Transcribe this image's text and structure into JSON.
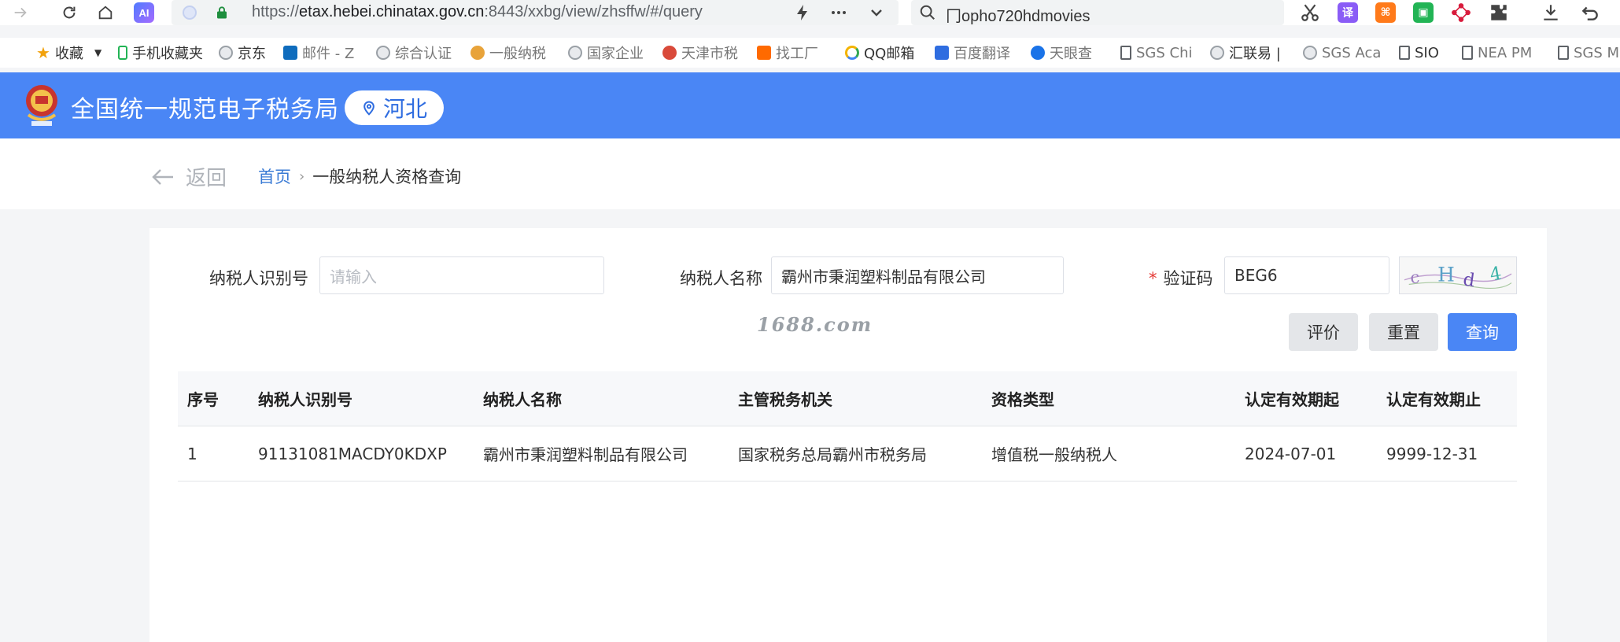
{
  "browser": {
    "url_prefix": "https://",
    "url_host": "etax.hebei.chinatax.gov.cn",
    "url_rest": ":8443/xxbg/view/zhsffw/#/query",
    "ai_badge": "AI",
    "search_text": "冂opho720hdmovies",
    "ext_translate": "译"
  },
  "bookmarks": [
    {
      "label": "收藏"
    },
    {
      "label": "手机收藏夹"
    },
    {
      "label": "京东"
    },
    {
      "label": "邮件 - Z"
    },
    {
      "label": "综合认证"
    },
    {
      "label": "一般纳税"
    },
    {
      "label": "国家企业"
    },
    {
      "label": "天津市税"
    },
    {
      "label": "找工厂"
    },
    {
      "label": "QQ邮箱"
    },
    {
      "label": "百度翻译"
    },
    {
      "label": "天眼查"
    },
    {
      "label": "SGS Chi"
    },
    {
      "label": "汇联易 |"
    },
    {
      "label": "SGS Aca"
    },
    {
      "label": "SIO"
    },
    {
      "label": "NEA PM"
    },
    {
      "label": "SGS M"
    }
  ],
  "header": {
    "title": "全国统一规范电子税务局",
    "region": "河北"
  },
  "subbar": {
    "back_label": "返回",
    "breadcrumb_home": "首页",
    "breadcrumb_sep": "›",
    "breadcrumb_current": "一般纳税人资格查询"
  },
  "form": {
    "taxpayer_id_label": "纳税人识别号",
    "taxpayer_id_placeholder": "请输入",
    "taxpayer_name_label": "纳税人名称",
    "taxpayer_name_value": "霸州市秉润塑料制品有限公司",
    "captcha_label": "验证码",
    "captcha_required_mark": "*",
    "captcha_value": "BEG6",
    "watermark": "1688.com"
  },
  "buttons": {
    "evaluate": "评价",
    "reset": "重置",
    "query": "查询"
  },
  "table": {
    "headers": [
      "序号",
      "纳税人识别号",
      "纳税人名称",
      "主管税务机关",
      "资格类型",
      "认定有效期起",
      "认定有效期止"
    ],
    "rows": [
      [
        "1",
        "91131081MACDY0KDXP",
        "霸州市秉润塑料制品有限公司",
        "国家税务总局霸州市税务局",
        "增值税一般纳税人",
        "2024-07-01",
        "9999-12-31"
      ]
    ]
  },
  "colors": {
    "brand_blue": "#4a86f5",
    "link_blue": "#3a7bd5",
    "required_red": "#e53935"
  }
}
